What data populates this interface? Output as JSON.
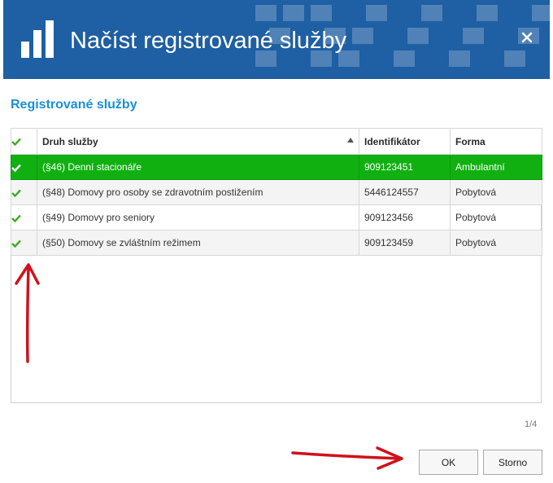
{
  "dialog": {
    "title": "Načíst registrované služby",
    "section_title": "Registrované služby"
  },
  "colors": {
    "header_bg": "#1f5fa3",
    "accent_title": "#1a8fd6",
    "selected_row": "#10b010",
    "check_green": "#3cad26",
    "annotation_red": "#d0111b"
  },
  "table": {
    "columns": [
      "Druh služby",
      "Identifikátor",
      "Forma"
    ],
    "rows": [
      {
        "druh": "(§46) Denní stacionáře",
        "id": "909123451",
        "forma": "Ambulantní"
      },
      {
        "druh": "(§48) Domovy pro osoby se zdravotním postižením",
        "id": "5446124557",
        "forma": "Pobytová"
      },
      {
        "druh": "(§49) Domovy pro seniory",
        "id": "909123456",
        "forma": "Pobytová"
      },
      {
        "druh": "(§50) Domovy se zvláštním režimem",
        "id": "909123459",
        "forma": "Pobytová"
      }
    ]
  },
  "pager": "1/4",
  "buttons": {
    "ok": "OK",
    "cancel": "Storno"
  }
}
